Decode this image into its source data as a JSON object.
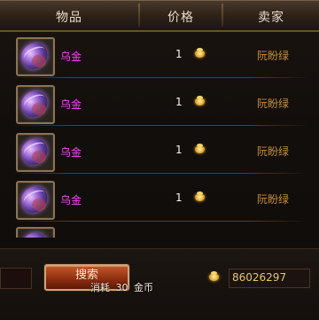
{
  "header": {
    "col_item": "物品",
    "col_price": "价格",
    "col_seller": "卖家"
  },
  "listings": [
    {
      "item_name": "乌金",
      "price": "1",
      "seller": "阮盼绿",
      "icon": "ore-gem-icon"
    },
    {
      "item_name": "乌金",
      "price": "1",
      "seller": "阮盼绿",
      "icon": "ore-gem-icon"
    },
    {
      "item_name": "乌金",
      "price": "1",
      "seller": "阮盼绿",
      "icon": "ore-gem-icon"
    },
    {
      "item_name": "乌金",
      "price": "1",
      "seller": "阮盼绿",
      "icon": "ore-gem-icon"
    }
  ],
  "search": {
    "button_label": "搜索",
    "cost_prefix": "消耗",
    "cost_amount": "30",
    "cost_unit": "金币"
  },
  "wallet": {
    "gold_amount": "86026297",
    "currency_icon": "gold-ingot-icon"
  },
  "colors": {
    "item_name": "#ff44ff",
    "seller": "#c98d3e",
    "gold": "#e9c46a"
  }
}
